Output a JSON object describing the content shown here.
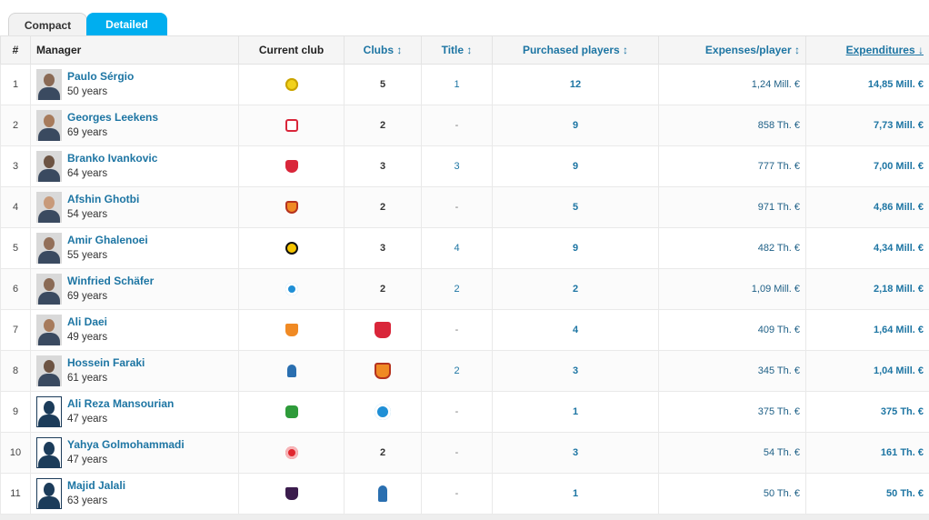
{
  "tabs": [
    {
      "label": "Compact",
      "active": false
    },
    {
      "label": "Detailed",
      "active": true
    }
  ],
  "columns": {
    "rank": "#",
    "manager": "Manager",
    "current_club": "Current club",
    "clubs": "Clubs",
    "title": "Title",
    "purchased": "Purchased players",
    "expenses": "Expenses/player",
    "expenditures": "Expenditures",
    "sort_icon": "↕",
    "sort_desc_icon": "↓"
  },
  "colors": {
    "accent": "#00aeef",
    "link": "#1d75a3"
  },
  "rows": [
    {
      "rank": "1",
      "name": "Paulo Sérgio",
      "age": "50 years",
      "current_club": "crest-yellow",
      "club_col": "",
      "clubs": "5",
      "title": "1",
      "purchased": "12",
      "expenses": "1,24 Mill. €",
      "expenditures": "14,85 Mill. €"
    },
    {
      "rank": "2",
      "name": "Georges Leekens",
      "age": "69 years",
      "current_club": "crest-red-shield",
      "club_col": "",
      "clubs": "2",
      "title": "-",
      "purchased": "9",
      "expenses": "858 Th. €",
      "expenditures": "7,73 Mill. €"
    },
    {
      "rank": "3",
      "name": "Branko Ivankovic",
      "age": "64 years",
      "current_club": "crest-persepolis",
      "club_col": "",
      "clubs": "3",
      "title": "3",
      "purchased": "9",
      "expenses": "777 Th. €",
      "expenditures": "7,00 Mill. €"
    },
    {
      "rank": "4",
      "name": "Afshin Ghotbi",
      "age": "54 years",
      "current_club": "crest-foolad",
      "club_col": "",
      "clubs": "2",
      "title": "-",
      "purchased": "5",
      "expenses": "971 Th. €",
      "expenditures": "4,86 Mill. €"
    },
    {
      "rank": "5",
      "name": "Amir Ghalenoei",
      "age": "55 years",
      "current_club": "crest-sepahan",
      "club_col": "",
      "clubs": "3",
      "title": "4",
      "purchased": "9",
      "expenses": "482 Th. €",
      "expenditures": "4,34 Mill. €"
    },
    {
      "rank": "6",
      "name": "Winfried Schäfer",
      "age": "69 years",
      "current_club": "crest-esteghlal",
      "club_col": "",
      "clubs": "2",
      "title": "2",
      "purchased": "2",
      "expenses": "1,09 Mill. €",
      "expenditures": "2,18 Mill. €"
    },
    {
      "rank": "7",
      "name": "Ali Daei",
      "age": "49 years",
      "current_club": "crest-orange",
      "club_col": "crest-persepolis",
      "clubs": "",
      "title": "-",
      "purchased": "4",
      "expenses": "409 Th. €",
      "expenditures": "1,64 Mill. €"
    },
    {
      "rank": "8",
      "name": "Hossein Faraki",
      "age": "61 years",
      "current_club": "crest-mascot",
      "club_col": "crest-foolad",
      "clubs": "",
      "title": "2",
      "purchased": "3",
      "expenses": "345 Th. €",
      "expenditures": "1,04 Mill. €"
    },
    {
      "rank": "9",
      "name": "Ali Reza Mansourian",
      "age": "47 years",
      "current_club": "crest-green",
      "club_col": "crest-esteghlal",
      "clubs": "",
      "title": "-",
      "purchased": "1",
      "expenses": "375 Th. €",
      "expenditures": "375 Th. €"
    },
    {
      "rank": "10",
      "name": "Yahya Golmohammadi",
      "age": "47 years",
      "current_club": "crest-red-round",
      "club_col": "",
      "clubs": "2",
      "title": "-",
      "purchased": "3",
      "expenses": "54 Th. €",
      "expenditures": "161 Th. €"
    },
    {
      "rank": "11",
      "name": "Majid Jalali",
      "age": "63 years",
      "current_club": "crest-dark",
      "club_col": "crest-mascot",
      "clubs": "",
      "title": "-",
      "purchased": "1",
      "expenses": "50 Th. €",
      "expenditures": "50 Th. €"
    }
  ]
}
